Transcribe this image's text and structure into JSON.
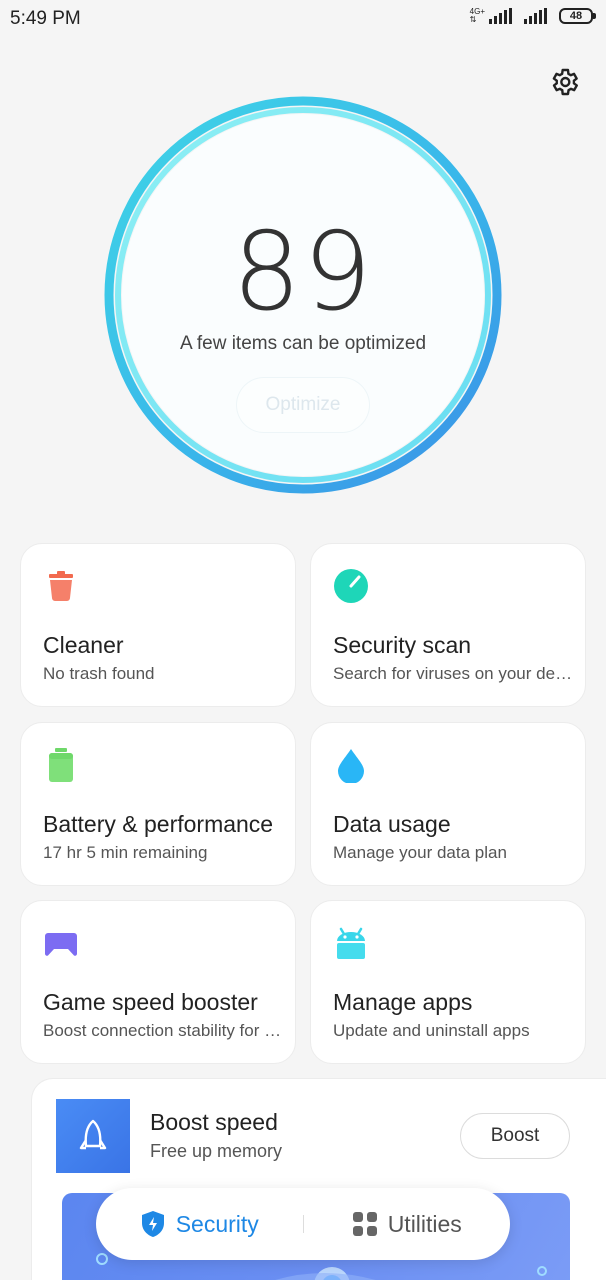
{
  "status_bar": {
    "time": "5:49 PM",
    "network_top": "4G+",
    "network_bottom": "⇅",
    "battery_level": "48"
  },
  "header": {
    "settings_icon": "gear-icon"
  },
  "score": {
    "value": "89",
    "caption": "A few items can be optimized",
    "optimize_label": "Optimize"
  },
  "tiles": [
    {
      "title": "Cleaner",
      "subtitle": "No trash found",
      "icon": "trash-icon",
      "color": "#f26a4f"
    },
    {
      "title": "Security scan",
      "subtitle": "Search for viruses on your device",
      "icon": "shield-scan-icon",
      "color": "#1ed6b8"
    },
    {
      "title": "Battery & performance",
      "subtitle": "17 hr 5 min  remaining",
      "icon": "battery-icon",
      "color": "#6fd86a"
    },
    {
      "title": "Data usage",
      "subtitle": "Manage your data plan",
      "icon": "droplet-icon",
      "color": "#29b6f6"
    },
    {
      "title": "Game speed booster",
      "subtitle": "Boost connection stability for games",
      "icon": "gamepad-icon",
      "color": "#7c6cf2"
    },
    {
      "title": "Manage apps",
      "subtitle": "Update and uninstall apps",
      "icon": "android-icon",
      "color": "#38d6ea"
    }
  ],
  "boost": {
    "title": "Boost speed",
    "subtitle": "Free up memory",
    "button_label": "Boost",
    "icon": "rocket-icon"
  },
  "bottom_nav": {
    "security_label": "Security",
    "utilities_label": "Utilities",
    "active": "security"
  }
}
